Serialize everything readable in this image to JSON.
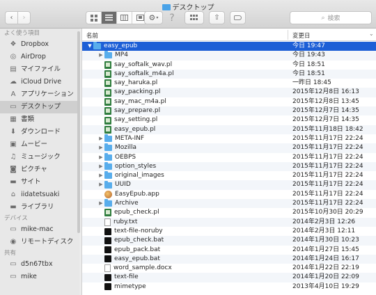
{
  "window": {
    "title": "デスクトップ"
  },
  "toolbar": {
    "search_placeholder": "検索"
  },
  "sidebar": {
    "favorites_header": "よく使う項目",
    "favorites": [
      {
        "label": "Dropbox",
        "icon": "dropbox-icon"
      },
      {
        "label": "AirDrop",
        "icon": "airdrop-icon"
      },
      {
        "label": "マイファイル",
        "icon": "all-files-icon"
      },
      {
        "label": "iCloud Drive",
        "icon": "cloud-icon"
      },
      {
        "label": "アプリケーション",
        "icon": "applications-icon"
      },
      {
        "label": "デスクトップ",
        "icon": "desktop-icon",
        "selected": true
      },
      {
        "label": "書類",
        "icon": "documents-icon"
      },
      {
        "label": "ダウンロード",
        "icon": "downloads-icon"
      },
      {
        "label": "ムービー",
        "icon": "movies-icon"
      },
      {
        "label": "ミュージック",
        "icon": "music-icon"
      },
      {
        "label": "ピクチャ",
        "icon": "pictures-icon"
      },
      {
        "label": "サイト",
        "icon": "sites-folder-icon"
      },
      {
        "label": "iidatetsuaki",
        "icon": "home-icon"
      },
      {
        "label": "ライブラリ",
        "icon": "library-folder-icon"
      }
    ],
    "devices_header": "デバイス",
    "devices": [
      {
        "label": "mike-mac",
        "icon": "computer-icon"
      },
      {
        "label": "リモートディスク",
        "icon": "remote-disc-icon"
      }
    ],
    "shared_header": "共有",
    "shared": [
      {
        "label": "d5n67tbx",
        "icon": "network-computer-icon"
      },
      {
        "label": "mike",
        "icon": "network-computer-icon"
      }
    ]
  },
  "list": {
    "col_name": "名前",
    "col_date": "変更日",
    "rows": [
      {
        "name": "easy_epub",
        "date": "今日 19:47",
        "type": "folder",
        "level": 0,
        "disclosure": "open",
        "selected": true
      },
      {
        "name": "MP4",
        "date": "今日 19:43",
        "type": "folder",
        "level": 1,
        "disclosure": "closed"
      },
      {
        "name": "say_softalk_wav.pl",
        "date": "今日 18:51",
        "type": "pl",
        "level": 1
      },
      {
        "name": "say_softalk_m4a.pl",
        "date": "今日 18:51",
        "type": "pl",
        "level": 1
      },
      {
        "name": "say_haruka.pl",
        "date": "一昨日 18:45",
        "type": "pl",
        "level": 1
      },
      {
        "name": "say_packing.pl",
        "date": "2015年12月8日 16:13",
        "type": "pl",
        "level": 1
      },
      {
        "name": "say_mac_m4a.pl",
        "date": "2015年12月8日 13:45",
        "type": "pl",
        "level": 1
      },
      {
        "name": "say_prepare.pl",
        "date": "2015年12月7日 14:35",
        "type": "pl",
        "level": 1
      },
      {
        "name": "say_setting.pl",
        "date": "2015年12月7日 14:35",
        "type": "pl",
        "level": 1
      },
      {
        "name": "easy_epub.pl",
        "date": "2015年11月18日 18:42",
        "type": "pl",
        "level": 1
      },
      {
        "name": "META-INF",
        "date": "2015年11月17日 22:24",
        "type": "folder",
        "level": 1,
        "disclosure": "closed"
      },
      {
        "name": "Mozilla",
        "date": "2015年11月17日 22:24",
        "type": "folder",
        "level": 1,
        "disclosure": "closed"
      },
      {
        "name": "OEBPS",
        "date": "2015年11月17日 22:24",
        "type": "folder",
        "level": 1,
        "disclosure": "closed"
      },
      {
        "name": "option_styles",
        "date": "2015年11月17日 22:24",
        "type": "folder",
        "level": 1,
        "disclosure": "closed"
      },
      {
        "name": "original_images",
        "date": "2015年11月17日 22:24",
        "type": "folder",
        "level": 1,
        "disclosure": "closed"
      },
      {
        "name": "UUID",
        "date": "2015年11月17日 22:24",
        "type": "folder",
        "level": 1,
        "disclosure": "closed"
      },
      {
        "name": "EasyEpub.app",
        "date": "2015年11月17日 22:24",
        "type": "app",
        "level": 1
      },
      {
        "name": "Archive",
        "date": "2015年11月17日 22:24",
        "type": "folder",
        "level": 1,
        "disclosure": "closed"
      },
      {
        "name": "epub_check.pl",
        "date": "2015年10月30日 20:29",
        "type": "pl",
        "level": 1
      },
      {
        "name": "ruby.txt",
        "date": "2014年2月3日 12:26",
        "type": "txt",
        "level": 1
      },
      {
        "name": "text-file-noruby",
        "date": "2014年2月3日 12:11",
        "type": "term",
        "level": 1
      },
      {
        "name": "epub_check.bat",
        "date": "2014年1月30日 10:23",
        "type": "term",
        "level": 1
      },
      {
        "name": "epub_pack.bat",
        "date": "2014年1月27日 15:45",
        "type": "term",
        "level": 1
      },
      {
        "name": "easy_epub.bat",
        "date": "2014年1月24日 16:17",
        "type": "term",
        "level": 1
      },
      {
        "name": "word_sample.docx",
        "date": "2014年1月22日 22:19",
        "type": "doc",
        "level": 1
      },
      {
        "name": "text-file",
        "date": "2014年1月20日 22:09",
        "type": "term",
        "level": 1
      },
      {
        "name": "mimetype",
        "date": "2013年4月10日 19:29",
        "type": "term",
        "level": 1
      }
    ]
  }
}
